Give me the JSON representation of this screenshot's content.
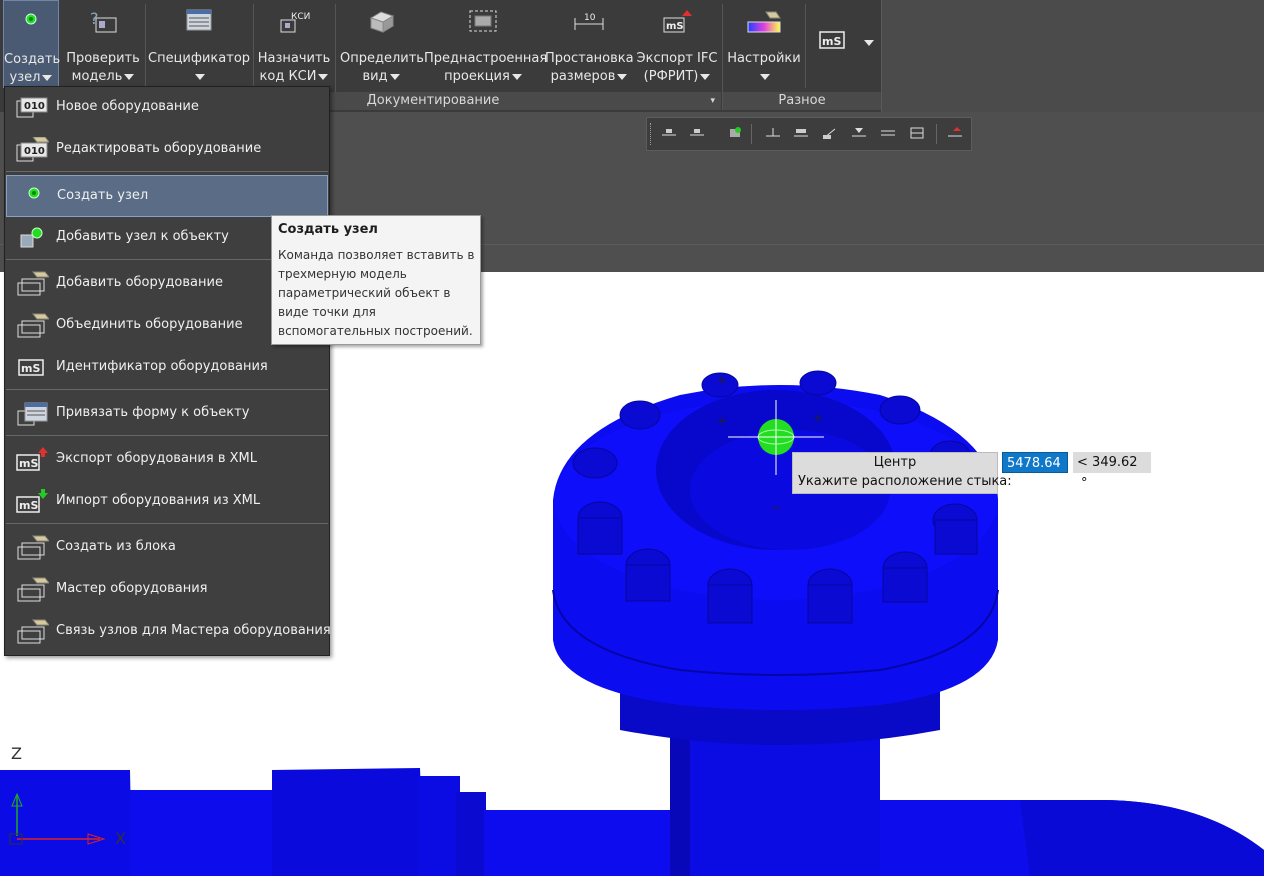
{
  "ribbon": {
    "buttons": [
      {
        "line1": "Создать",
        "line2": "узел"
      },
      {
        "line1": "Проверить",
        "line2": "модель"
      },
      {
        "line1": "Спецификатор",
        "line2": ""
      },
      {
        "line1": "Назначить",
        "line2": "код КСИ"
      },
      {
        "line1": "Определить",
        "line2": "вид"
      },
      {
        "line1": "Преднастроенная",
        "line2": "проекция"
      },
      {
        "line1": "Простановка",
        "line2": "размеров"
      },
      {
        "line1": "Экспорт IFC",
        "line2": "(РФРИТ)"
      },
      {
        "line1": "Настройки",
        "line2": ""
      }
    ],
    "ksi_icon_text": "КСИ",
    "dim_icon_text": "10",
    "ms_icon_text": "mS",
    "groups": {
      "documenting": "Документирование",
      "misc": "Разное"
    }
  },
  "menu": {
    "items": [
      {
        "label": "Новое оборудование",
        "icon": "equipment-010-icon"
      },
      {
        "label": "Редактировать оборудование",
        "icon": "edit-equipment-icon"
      },
      {
        "label": "Создать узел",
        "icon": "node-point-icon"
      },
      {
        "label": "Добавить узел к объекту",
        "icon": "add-node-icon"
      },
      {
        "label": "Добавить оборудование",
        "icon": "add-equipment-icon"
      },
      {
        "label": "Объединить оборудование",
        "icon": "merge-equipment-icon"
      },
      {
        "label": "Идентификатор оборудования",
        "icon": "ms-identifier-icon"
      },
      {
        "label": "Привязать форму к объекту",
        "icon": "bind-form-icon"
      },
      {
        "label": "Экспорт оборудования в XML",
        "icon": "export-xml-icon"
      },
      {
        "label": "Импорт оборудования из XML",
        "icon": "import-xml-icon"
      },
      {
        "label": "Создать из блока",
        "icon": "create-from-block-icon"
      },
      {
        "label": "Мастер оборудования",
        "icon": "equipment-wizard-icon"
      },
      {
        "label": "Связь узлов для Мастера оборудования",
        "icon": "node-link-icon"
      }
    ],
    "icon_text_010": "010",
    "icon_text_ms": "mS"
  },
  "tooltip": {
    "title": "Создать узел",
    "description": "Команда позволяет вставить в трехмерную модель параметрический объект в виде точки для вспомогательных построений."
  },
  "dynamic_input": {
    "title": "Центр",
    "prompt": "Укажите расположение стыка:",
    "distance": "5478.64",
    "angle_prefix": "<",
    "angle": "349.62",
    "angle_unit": "°"
  },
  "ucs": {
    "z": "Z",
    "x": "X"
  },
  "colors": {
    "model": "#0a0ae6",
    "node": "#22dd22",
    "ribbon": "#3b3b3b",
    "highlight": "#5a6c86"
  }
}
